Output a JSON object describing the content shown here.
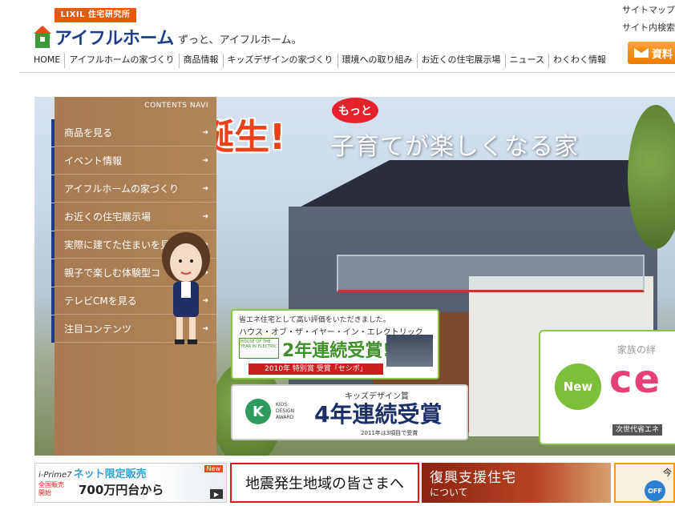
{
  "header": {
    "lixil_label": "LIXIL 住宅研究所",
    "brand_name": "アイフルホーム",
    "slogan": "ずっと、アイフルホーム。",
    "util_links": [
      "サイトマップ",
      "サイト内検索"
    ],
    "catalog_button": "資料"
  },
  "global_nav": [
    "HOME",
    "アイフルホームの家づくり",
    "商品情報",
    "キッズデザインの家づくり",
    "環境への取り組み",
    "お近くの住宅展示場",
    "ニュース",
    "わくわく情報"
  ],
  "hero": {
    "headline_kanji": "誕生!",
    "bubble": "もっと",
    "headline_sub": "子育てが楽しくなる家"
  },
  "contents_navi": {
    "title": "CONTENTS NAVI",
    "items": [
      "商品を見る",
      "イベント情報",
      "アイフルホームの家づくり",
      "お近くの住宅展示場",
      "実際に建てた住まいを見",
      "親子で楽しむ体験型コ",
      "テレビCMを見る",
      "注目コンテンツ"
    ]
  },
  "award1": {
    "line1": "省エネ住宅として高い評価をいただきました。",
    "line2": "ハウス・オブ・ザ・イヤー・イン・エレクトリック",
    "logo_text": "HOUSE OF THE YEAR IN ELECTRIC",
    "big": "2年連続受賞!",
    "ribbon": "2010年 特別賞 受賞「セシボ」"
  },
  "award2": {
    "logo_letter": "K",
    "logo_text_1": "KIDS",
    "logo_text_2": "DESIGN",
    "logo_text_3": "AWARD",
    "small": "キッズデザイン賞",
    "big": "4年連続受賞",
    "note": "2011年は3項目で受賞"
  },
  "ce_box": {
    "kazoku": "家族の絆",
    "new_label": "New",
    "ce_text": "ce",
    "next_label": "次世代省エネ"
  },
  "banners": {
    "b1_prefix": "i-Prime7",
    "b1_title": "ネット限定販売",
    "b1_area_1": "全国販売",
    "b1_area_2": "開始",
    "b1_price": "700万円台から",
    "b1_new": "New",
    "b2_text": "地震発生地域の皆さまへ",
    "b3_title": "復興支援住宅",
    "b3_sub": "について",
    "b4_off": "OFF",
    "b4_text": "今"
  }
}
